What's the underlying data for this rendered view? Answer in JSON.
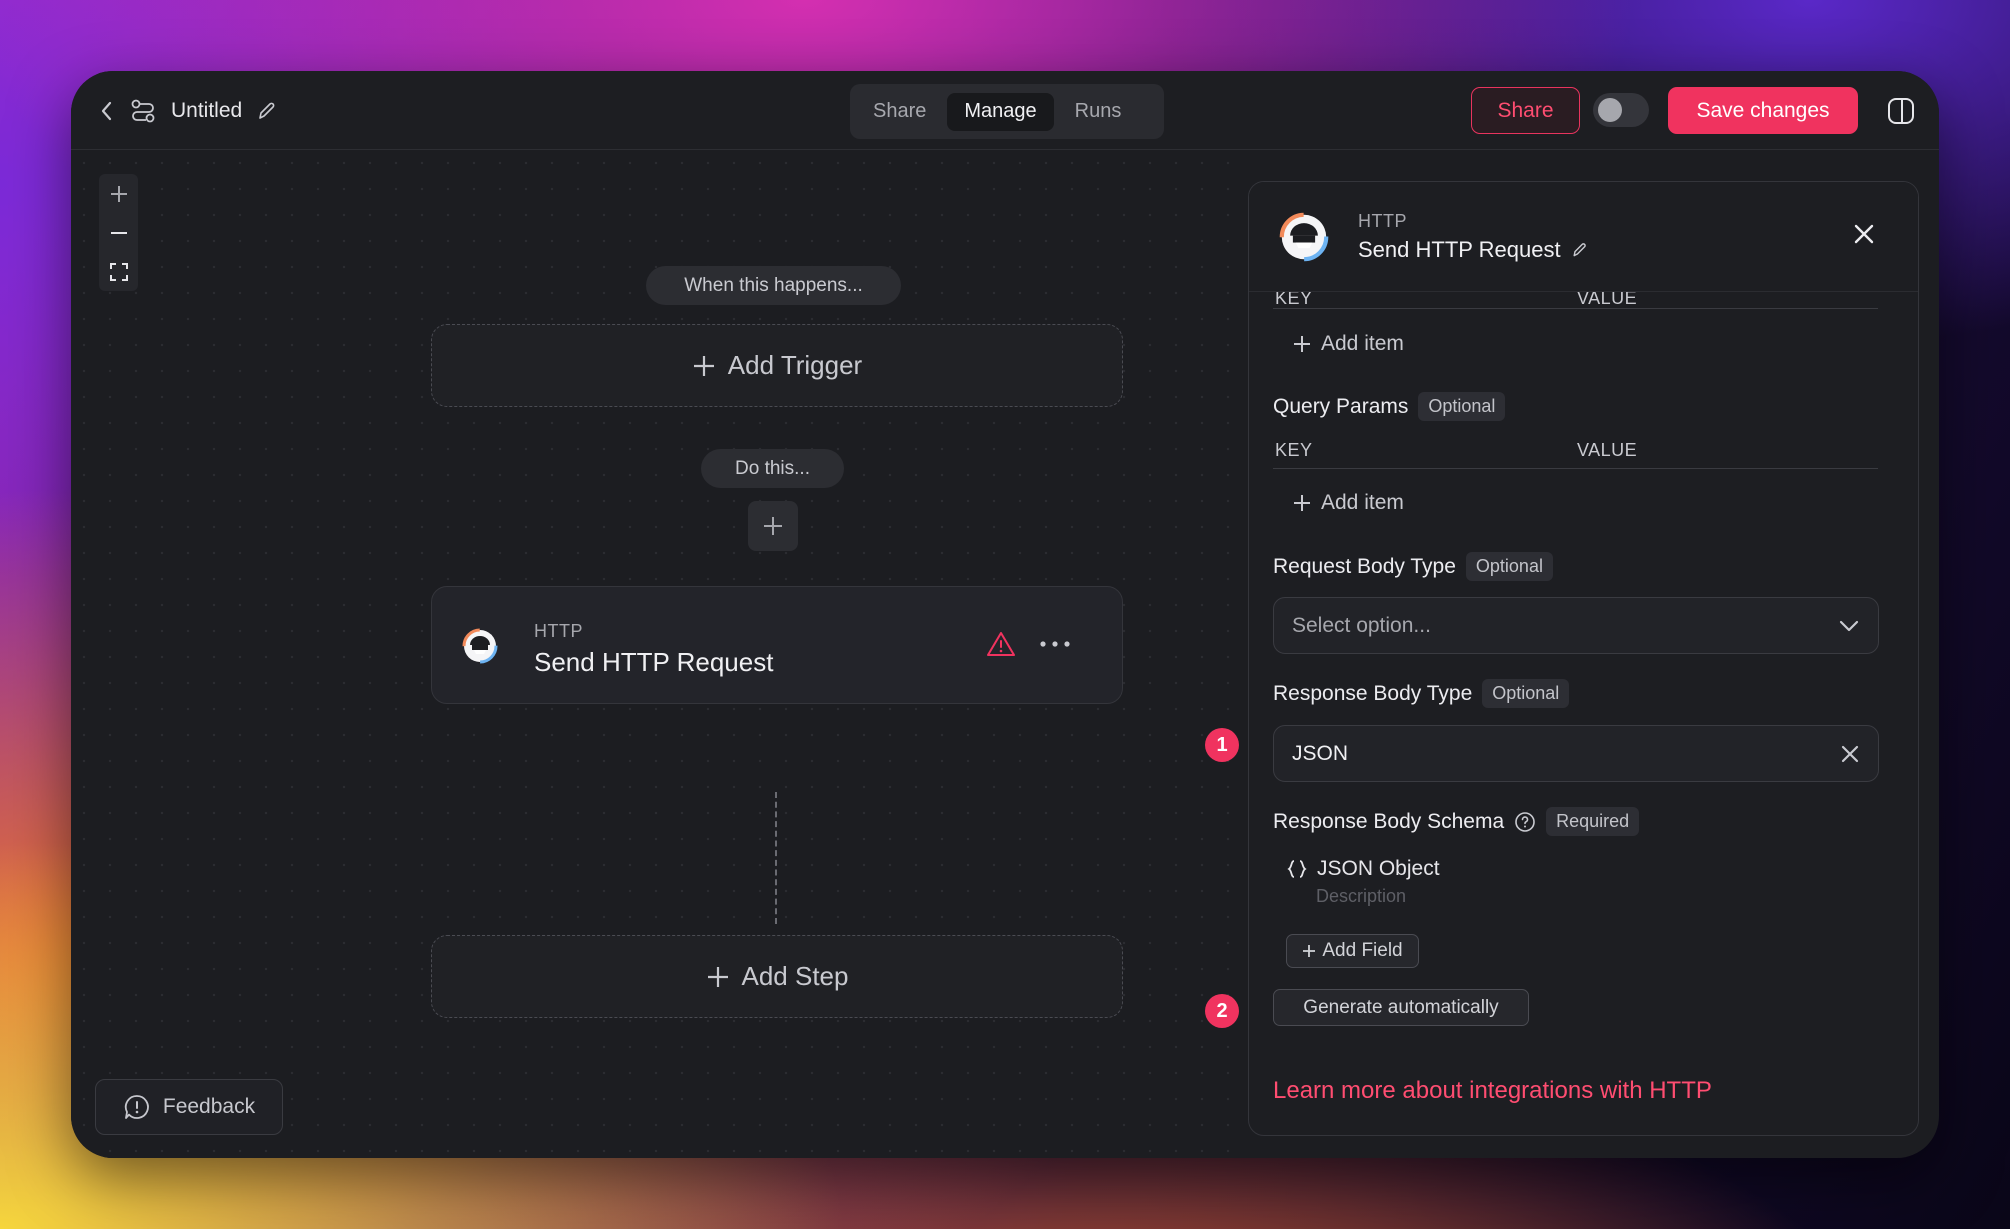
{
  "header": {
    "title": "Untitled",
    "tabs": [
      {
        "label": "Share",
        "active": false
      },
      {
        "label": "Manage",
        "active": true
      },
      {
        "label": "Runs",
        "active": false
      }
    ],
    "share_label": "Share",
    "save_label": "Save changes"
  },
  "canvas": {
    "when_label": "When this happens...",
    "add_trigger_label": "Add Trigger",
    "do_label": "Do this...",
    "step": {
      "app": "HTTP",
      "name": "Send HTTP Request"
    },
    "add_step_label": "Add Step",
    "feedback_label": "Feedback"
  },
  "annotations": [
    "1",
    "2"
  ],
  "panel": {
    "app": "HTTP",
    "name": "Send HTTP Request",
    "headers_cols": {
      "key": "KEY",
      "value": "VALUE"
    },
    "add_item_label": "Add item",
    "query_params": {
      "label": "Query Params",
      "tag": "Optional",
      "key_col": "KEY",
      "value_col": "VALUE",
      "add_item_label": "Add item"
    },
    "request_body_type": {
      "label": "Request Body Type",
      "tag": "Optional",
      "placeholder": "Select option..."
    },
    "response_body_type": {
      "label": "Response Body Type",
      "tag": "Optional",
      "value": "JSON"
    },
    "response_body_schema": {
      "label": "Response Body Schema",
      "tag": "Required",
      "object_label": "JSON Object",
      "description_placeholder": "Description",
      "add_field_label": "Add Field",
      "generate_label": "Generate automatically"
    },
    "learn_more": "Learn more about integrations with HTTP"
  },
  "colors": {
    "accent": "#f0335f",
    "window_bg": "#1c1d21"
  }
}
